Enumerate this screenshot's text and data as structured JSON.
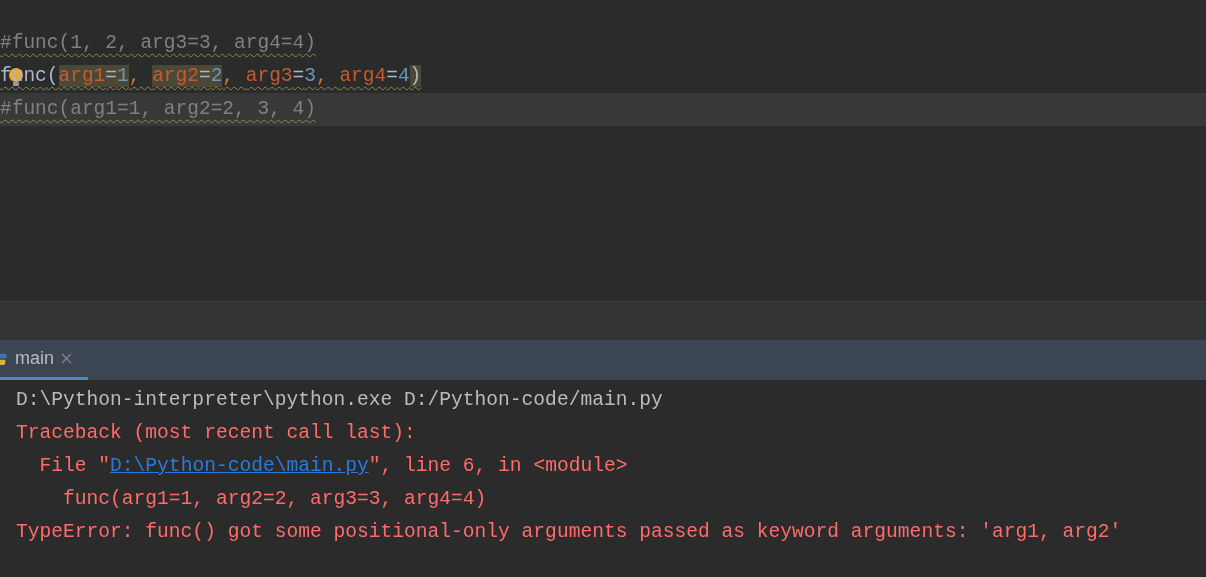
{
  "editor": {
    "lines": [
      {
        "current": false,
        "warning": true,
        "tokens": [
          {
            "kind": "comment",
            "text": "#func(1, 2, arg3=3, arg4=4)",
            "highlight": false
          }
        ]
      },
      {
        "current": false,
        "warning": true,
        "tokens": [
          {
            "kind": "ident",
            "text": "func",
            "highlight": false
          },
          {
            "kind": "punct",
            "text": "(",
            "highlight": false
          },
          {
            "kind": "param",
            "text": "arg1",
            "highlight": true
          },
          {
            "kind": "punct",
            "text": "=",
            "highlight": true
          },
          {
            "kind": "number",
            "text": "1",
            "highlight": true
          },
          {
            "kind": "comma",
            "text": ", ",
            "highlight": false
          },
          {
            "kind": "param",
            "text": "arg2",
            "highlight": true
          },
          {
            "kind": "punct",
            "text": "=",
            "highlight": true
          },
          {
            "kind": "number",
            "text": "2",
            "highlight": true
          },
          {
            "kind": "comma",
            "text": ", ",
            "highlight": false
          },
          {
            "kind": "param",
            "text": "arg3",
            "highlight": false
          },
          {
            "kind": "punct",
            "text": "=",
            "highlight": false
          },
          {
            "kind": "number",
            "text": "3",
            "highlight": false
          },
          {
            "kind": "comma",
            "text": ", ",
            "highlight": false
          },
          {
            "kind": "param",
            "text": "arg4",
            "highlight": false
          },
          {
            "kind": "punct",
            "text": "=",
            "highlight": false
          },
          {
            "kind": "number",
            "text": "4",
            "highlight": false
          },
          {
            "kind": "punct",
            "text": ")",
            "highlight": true
          }
        ]
      },
      {
        "current": true,
        "warning": true,
        "tokens": [
          {
            "kind": "comment",
            "text": "#func(arg1=1, arg2=2, 3, 4)",
            "highlight": false
          }
        ]
      }
    ]
  },
  "run_panel": {
    "tabs": [
      {
        "label": "main",
        "selected": true
      }
    ],
    "console": [
      {
        "kind": "output",
        "segments": [
          {
            "text": "D:\\Python-interpreter\\python.exe D:/Python-code/main.py",
            "kind": "text"
          }
        ]
      },
      {
        "kind": "error",
        "segments": [
          {
            "text": "Traceback (most recent call last):",
            "kind": "text"
          }
        ]
      },
      {
        "kind": "error",
        "segments": [
          {
            "text": "  File \"",
            "kind": "text"
          },
          {
            "text": "D:\\Python-code\\main.py",
            "kind": "link"
          },
          {
            "text": "\", line 6, in <module>",
            "kind": "text"
          }
        ]
      },
      {
        "kind": "error",
        "segments": [
          {
            "text": "    func(arg1=1, arg2=2, arg3=3, arg4=4)",
            "kind": "text"
          }
        ]
      },
      {
        "kind": "error",
        "segments": [
          {
            "text": "TypeError: func() got some positional-only arguments passed as keyword arguments: 'arg1, arg2'",
            "kind": "text"
          }
        ]
      }
    ]
  }
}
